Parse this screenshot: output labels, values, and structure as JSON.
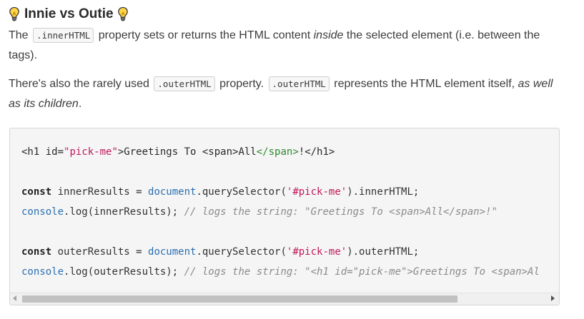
{
  "heading": {
    "title": "Innie vs Outie",
    "left_icon": "lightbulb-icon",
    "right_icon": "lightbulb-icon"
  },
  "para1": {
    "t1": "The",
    "code1": ".innerHTML",
    "t2": "property sets or returns the HTML content",
    "em1": "inside",
    "t3": "the selected element (i.e. between the tags)."
  },
  "para2": {
    "t1": "There's also the rarely used",
    "code1": ".outerHTML",
    "t2": "property.",
    "code2": ".outerHTML",
    "t3": "represents the HTML element itself,",
    "em1": "as well as its children",
    "t4": "."
  },
  "code": {
    "line1": {
      "a": "<h1 id=",
      "b": "\"pick-me\"",
      "c": ">Greetings To <span>All",
      "d": "</span>",
      "e": "!</h1>"
    },
    "line2": {
      "kw": "const",
      "a": " innerResults = ",
      "b": "document",
      "c": ".querySelector(",
      "d": "'#pick-me'",
      "e": ").innerHTML;"
    },
    "line3": {
      "a": "console",
      "b": ".log(innerResults); ",
      "c": "// logs the string: \"Greetings To <span>All</span>!\""
    },
    "line4": {
      "kw": "const",
      "a": " outerResults = ",
      "b": "document",
      "c": ".querySelector(",
      "d": "'#pick-me'",
      "e": ").outerHTML;"
    },
    "line5": {
      "a": "console",
      "b": ".log(outerResults); ",
      "c": "// logs the string: \"<h1 id=\"pick-me\">Greetings To <span>Al"
    }
  },
  "scrollbar": {
    "position": 0,
    "visible_fraction": 0.83
  },
  "colors": {
    "string": "#c0185a",
    "builtin": "#2a6fb0",
    "comment": "#8a8a8a",
    "closing_tag": "#2d8a2d",
    "code_bg": "#f5f5f5"
  }
}
